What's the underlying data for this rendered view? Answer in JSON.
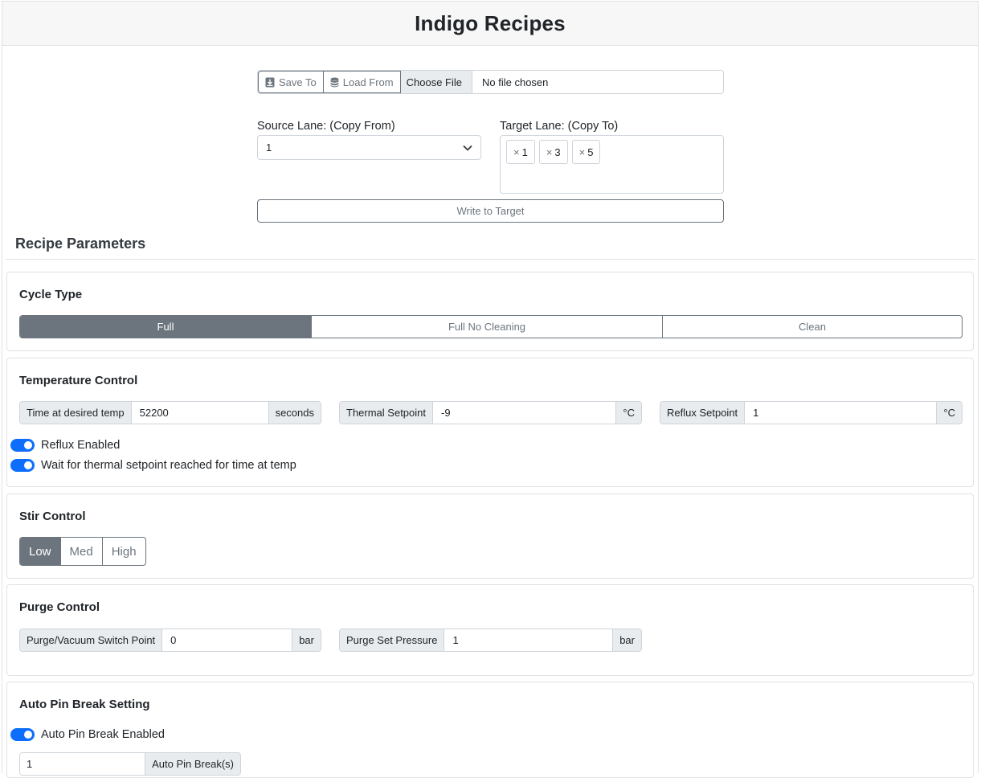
{
  "header": {
    "title": "Indigo Recipes"
  },
  "file_bar": {
    "save_label": "Save To",
    "load_label": "Load From",
    "choose_label": "Choose File",
    "file_name": "No file chosen",
    "save_icon": "download-icon",
    "load_icon": "database-icon"
  },
  "lanes": {
    "source_label": "Source Lane: (Copy From)",
    "source_value": "1",
    "target_label": "Target Lane: (Copy To)",
    "targets": [
      "1",
      "3",
      "5"
    ],
    "write_label": "Write to Target"
  },
  "recipe": {
    "title": "Recipe Parameters",
    "cycle": {
      "title": "Cycle Type",
      "options": [
        "Full",
        "Full No Cleaning",
        "Clean"
      ],
      "selected": "Full"
    },
    "temperature": {
      "title": "Temperature Control",
      "time_label": "Time at desired temp",
      "time_value": "52200",
      "time_unit": "seconds",
      "thermal_label": "Thermal Setpoint",
      "thermal_value": "-9",
      "thermal_unit": "°C",
      "reflux_label": "Reflux Setpoint",
      "reflux_value": "1",
      "reflux_unit": "°C",
      "reflux_enabled_label": "Reflux Enabled",
      "reflux_enabled": true,
      "wait_label": "Wait for thermal setpoint reached for time at temp",
      "wait_enabled": true
    },
    "stir": {
      "title": "Stir Control",
      "options": [
        "Low",
        "Med",
        "High"
      ],
      "selected": "Low"
    },
    "purge": {
      "title": "Purge Control",
      "switch_label": "Purge/Vacuum Switch Point",
      "switch_value": "0",
      "switch_unit": "bar",
      "pressure_label": "Purge Set Pressure",
      "pressure_value": "1",
      "pressure_unit": "bar"
    },
    "pin_break": {
      "title": "Auto Pin Break Setting",
      "enabled_label": "Auto Pin Break Enabled",
      "enabled": true,
      "count_value": "1",
      "count_label": "Auto Pin Break(s)"
    }
  },
  "colors": {
    "accent": "#0d6efd",
    "secondary": "#6c757d",
    "border": "#ced4da",
    "addon_bg": "#e9ecef"
  }
}
